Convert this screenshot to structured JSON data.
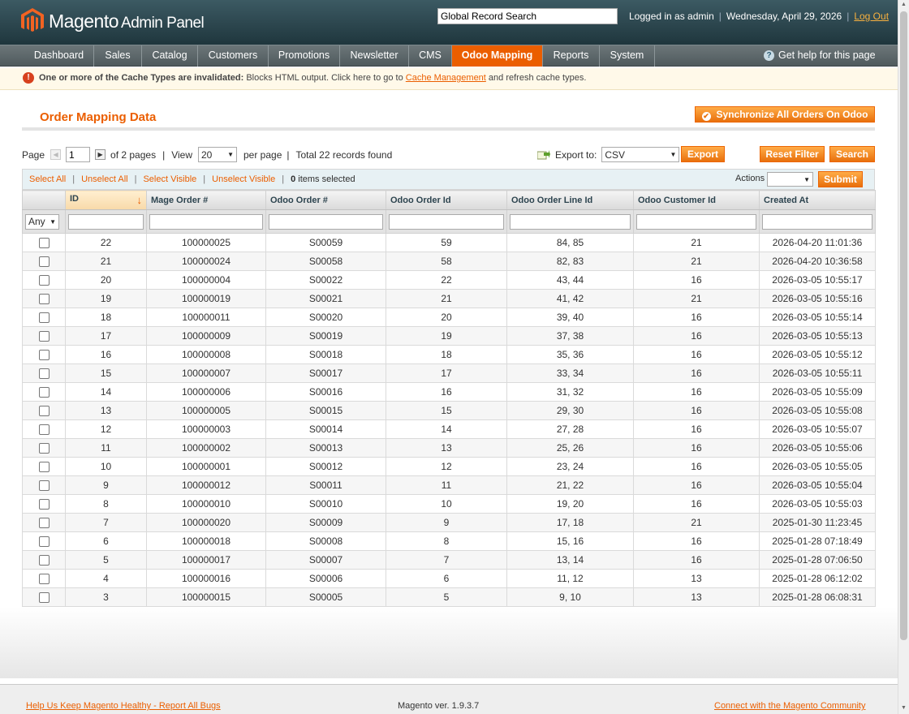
{
  "header": {
    "logo_text": "Magento",
    "logo_subtext": "Admin Panel",
    "search_value": "Global Record Search",
    "logged_in": "Logged in as admin",
    "date": "Wednesday, April 29, 2026",
    "logout": "Log Out"
  },
  "nav": {
    "items": [
      {
        "label": "Dashboard"
      },
      {
        "label": "Sales"
      },
      {
        "label": "Catalog"
      },
      {
        "label": "Customers"
      },
      {
        "label": "Promotions"
      },
      {
        "label": "Newsletter"
      },
      {
        "label": "CMS"
      },
      {
        "label": "Odoo Mapping"
      },
      {
        "label": "Reports"
      },
      {
        "label": "System"
      }
    ],
    "active_index": 7,
    "help": "Get help for this page"
  },
  "notice": {
    "bold": "One or more of the Cache Types are invalidated:",
    "text": "Blocks HTML output. Click here to go to",
    "link": "Cache Management",
    "text2": "and refresh cache types."
  },
  "page": {
    "title": "Order Mapping Data",
    "sync_button": "Synchronize All Orders On Odoo"
  },
  "pager": {
    "page_label": "Page",
    "page_value": "1",
    "of_pages": "of 2 pages",
    "sep": "|",
    "view_label": "View",
    "view_value": "20",
    "per_page": "per page",
    "total": "Total 22 records found",
    "export_label": "Export to:",
    "export_value": "CSV",
    "export_button": "Export",
    "reset_button": "Reset Filter",
    "search_button": "Search"
  },
  "massaction": {
    "select_all": "Select All",
    "unselect_all": "Unselect All",
    "select_visible": "Select Visible",
    "unselect_visible": "Unselect Visible",
    "pipe": "|",
    "count": "0",
    "selected_text": "items selected",
    "actions_label": "Actions",
    "submit": "Submit"
  },
  "grid": {
    "columns": [
      "ID",
      "Mage Order #",
      "Odoo Order #",
      "Odoo Order Id",
      "Odoo Order Line Id",
      "Odoo Customer Id",
      "Created At"
    ],
    "filter_any": "Any",
    "rows": [
      [
        "22",
        "100000025",
        "S00059",
        "59",
        "84, 85",
        "21",
        "2026-04-20 11:01:36"
      ],
      [
        "21",
        "100000024",
        "S00058",
        "58",
        "82, 83",
        "21",
        "2026-04-20 10:36:58"
      ],
      [
        "20",
        "100000004",
        "S00022",
        "22",
        "43, 44",
        "16",
        "2026-03-05 10:55:17"
      ],
      [
        "19",
        "100000019",
        "S00021",
        "21",
        "41, 42",
        "21",
        "2026-03-05 10:55:16"
      ],
      [
        "18",
        "100000011",
        "S00020",
        "20",
        "39, 40",
        "16",
        "2026-03-05 10:55:14"
      ],
      [
        "17",
        "100000009",
        "S00019",
        "19",
        "37, 38",
        "16",
        "2026-03-05 10:55:13"
      ],
      [
        "16",
        "100000008",
        "S00018",
        "18",
        "35, 36",
        "16",
        "2026-03-05 10:55:12"
      ],
      [
        "15",
        "100000007",
        "S00017",
        "17",
        "33, 34",
        "16",
        "2026-03-05 10:55:11"
      ],
      [
        "14",
        "100000006",
        "S00016",
        "16",
        "31, 32",
        "16",
        "2026-03-05 10:55:09"
      ],
      [
        "13",
        "100000005",
        "S00015",
        "15",
        "29, 30",
        "16",
        "2026-03-05 10:55:08"
      ],
      [
        "12",
        "100000003",
        "S00014",
        "14",
        "27, 28",
        "16",
        "2026-03-05 10:55:07"
      ],
      [
        "11",
        "100000002",
        "S00013",
        "13",
        "25, 26",
        "16",
        "2026-03-05 10:55:06"
      ],
      [
        "10",
        "100000001",
        "S00012",
        "12",
        "23, 24",
        "16",
        "2026-03-05 10:55:05"
      ],
      [
        "9",
        "100000012",
        "S00011",
        "11",
        "21, 22",
        "16",
        "2026-03-05 10:55:04"
      ],
      [
        "8",
        "100000010",
        "S00010",
        "10",
        "19, 20",
        "16",
        "2026-03-05 10:55:03"
      ],
      [
        "7",
        "100000020",
        "S00009",
        "9",
        "17, 18",
        "21",
        "2025-01-30 11:23:45"
      ],
      [
        "6",
        "100000018",
        "S00008",
        "8",
        "15, 16",
        "16",
        "2025-01-28 07:18:49"
      ],
      [
        "5",
        "100000017",
        "S00007",
        "7",
        "13, 14",
        "16",
        "2025-01-28 07:06:50"
      ],
      [
        "4",
        "100000016",
        "S00006",
        "6",
        "11, 12",
        "13",
        "2025-01-28 06:12:02"
      ],
      [
        "3",
        "100000015",
        "S00005",
        "5",
        "9, 10",
        "13",
        "2025-01-28 06:08:31"
      ]
    ]
  },
  "footer": {
    "report_bugs": "Help Us Keep Magento Healthy - Report All Bugs",
    "version": "Magento ver. 1.9.3.7",
    "community": "Connect with the Magento Community"
  },
  "colors": {
    "accent": "#eb5e00",
    "header_bg": "#2b464e",
    "nav_bg": "#5d6769"
  }
}
